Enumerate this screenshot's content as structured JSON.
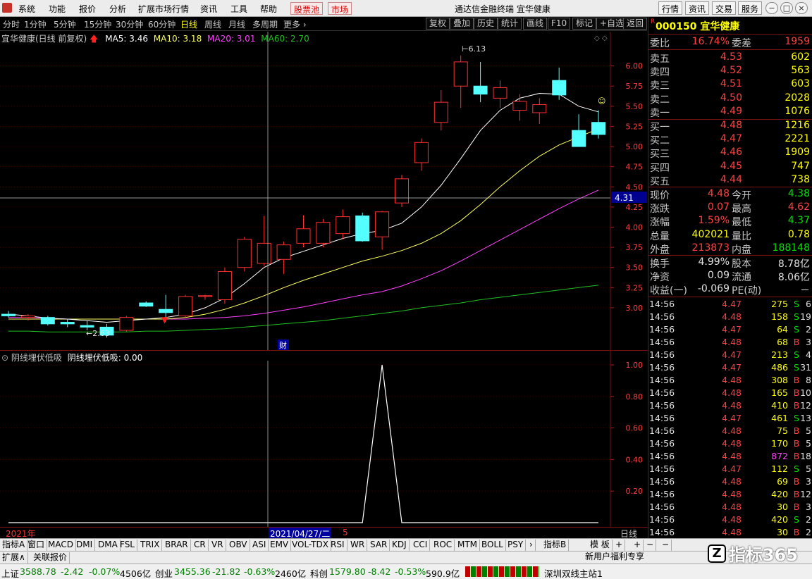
{
  "menu": {
    "items": [
      "系统",
      "功能",
      "报价",
      "分析",
      "扩展市场行情",
      "资讯",
      "工具",
      "帮助"
    ],
    "red_buttons": [
      "股票池",
      "市场"
    ],
    "app_title": "通达信金融终端",
    "stock_title": "宜华健康",
    "right_buttons": [
      "行情",
      "资讯",
      "交易",
      "服务"
    ]
  },
  "periods": {
    "items": [
      "分时",
      "1分钟",
      "5分钟",
      "15分钟",
      "30分钟",
      "60分钟",
      "日线",
      "周线",
      "月线",
      "多周期",
      "更多"
    ],
    "active": "日线",
    "tools": [
      "复权",
      "叠加",
      "历史",
      "统计",
      "画线",
      "F10",
      "标记",
      "+自选",
      "返回"
    ]
  },
  "chart_info": {
    "name": "宜华健康(日线 前复权)",
    "ma5": "MA5: 3.46",
    "ma10": "MA10: 3.18",
    "ma20": "MA20: 3.01",
    "ma60": "MA60: 2.70",
    "high_label": "6.13",
    "low_label": "2.63",
    "crosshair_price": "4.31",
    "cai_label": "财",
    "year_label": "2021年",
    "date_label": "2021/04/27/二",
    "month_label": "5",
    "period_label": "日线",
    "colors": {
      "up": "#ff3030",
      "down": "#54ffff",
      "ma5": "#ffffff",
      "ma10": "#ffff60",
      "ma20": "#ff40ff",
      "ma60": "#20c020"
    }
  },
  "indicator": {
    "title": "阴线埋伏低吸",
    "value": "阴线埋伏低吸: 0.00"
  },
  "chart_data": [
    {
      "type": "candlestick",
      "title": "宜华健康(日线 前复权)",
      "y_ticks": [
        "6.00",
        "5.75",
        "5.50",
        "5.25",
        "5.00",
        "4.75",
        "4.50",
        "4.25",
        "4.00",
        "3.75",
        "3.50",
        "3.25",
        "3.00"
      ],
      "ylim": [
        2.58,
        6.25
      ],
      "ohlc": [
        [
          2.92,
          2.96,
          2.88,
          2.9
        ],
        [
          2.88,
          2.92,
          2.84,
          2.9
        ],
        [
          2.88,
          2.9,
          2.78,
          2.8
        ],
        [
          2.82,
          2.86,
          2.76,
          2.8
        ],
        [
          2.78,
          2.84,
          2.72,
          2.76
        ],
        [
          2.76,
          2.8,
          2.63,
          2.66
        ],
        [
          2.72,
          2.9,
          2.7,
          2.88
        ],
        [
          3.06,
          3.08,
          3.01,
          3.02
        ],
        [
          2.98,
          3.16,
          2.88,
          2.94
        ],
        [
          2.9,
          3.16,
          2.88,
          3.14
        ],
        [
          3.14,
          3.16,
          3.1,
          3.15
        ],
        [
          3.1,
          3.5,
          3.05,
          3.45
        ],
        [
          3.5,
          3.88,
          3.45,
          3.85
        ],
        [
          3.55,
          4.14,
          3.52,
          3.8
        ],
        [
          3.6,
          3.82,
          3.42,
          3.78
        ],
        [
          3.8,
          4.15,
          3.75,
          3.98
        ],
        [
          3.8,
          4.1,
          3.75,
          4.06
        ],
        [
          3.92,
          4.22,
          3.85,
          4.13
        ],
        [
          4.14,
          4.18,
          3.82,
          3.83
        ],
        [
          3.88,
          4.2,
          3.72,
          4.19
        ],
        [
          4.3,
          4.65,
          4.25,
          4.6
        ],
        [
          4.8,
          5.1,
          4.7,
          5.05
        ],
        [
          5.3,
          5.7,
          5.2,
          5.55
        ],
        [
          5.75,
          6.13,
          5.48,
          6.05
        ],
        [
          5.75,
          6.05,
          5.55,
          5.65
        ],
        [
          5.6,
          5.82,
          5.48,
          5.73
        ],
        [
          5.45,
          5.65,
          5.32,
          5.56
        ],
        [
          5.42,
          5.6,
          5.28,
          5.52
        ],
        [
          5.82,
          5.98,
          5.58,
          5.64
        ],
        [
          5.2,
          5.4,
          5.0,
          5.0
        ],
        [
          5.3,
          5.45,
          5.1,
          5.15
        ]
      ],
      "ma5": [
        2.92,
        2.9,
        2.87,
        2.86,
        2.84,
        2.82,
        2.84,
        2.86,
        2.88,
        2.92,
        3.0,
        3.12,
        3.3,
        3.5,
        3.62,
        3.7,
        3.78,
        3.86,
        3.92,
        3.96,
        4.05,
        4.25,
        4.52,
        4.85,
        5.2,
        5.45,
        5.6,
        5.66,
        5.65,
        5.5,
        5.43
      ],
      "ma10": [
        2.86,
        2.86,
        2.86,
        2.86,
        2.86,
        2.86,
        2.86,
        2.86,
        2.86,
        2.88,
        2.92,
        2.98,
        3.06,
        3.15,
        3.25,
        3.34,
        3.42,
        3.5,
        3.58,
        3.64,
        3.71,
        3.8,
        3.92,
        4.08,
        4.28,
        4.5,
        4.7,
        4.88,
        5.02,
        5.12,
        5.22
      ],
      "ma20": [
        2.88,
        2.88,
        2.87,
        2.86,
        2.86,
        2.86,
        2.86,
        2.86,
        2.86,
        2.86,
        2.87,
        2.88,
        2.9,
        2.93,
        2.97,
        3.01,
        3.06,
        3.11,
        3.16,
        3.2,
        3.27,
        3.36,
        3.46,
        3.58,
        3.71,
        3.84,
        3.97,
        4.1,
        4.23,
        4.35,
        4.46
      ],
      "ma60": [
        2.71,
        2.71,
        2.7,
        2.7,
        2.7,
        2.7,
        2.7,
        2.71,
        2.71,
        2.72,
        2.73,
        2.74,
        2.76,
        2.78,
        2.8,
        2.82,
        2.84,
        2.87,
        2.9,
        2.93,
        2.96,
        3.0,
        3.03,
        3.06,
        3.1,
        3.13,
        3.16,
        3.19,
        3.22,
        3.25,
        3.28
      ]
    },
    {
      "type": "line",
      "title": "阴线埋伏低吸",
      "y_ticks": [
        "1.00",
        "0.80",
        "0.60",
        "0.40",
        "0.20"
      ],
      "ylim": [
        0,
        1.0
      ],
      "values": [
        0,
        0,
        0,
        0,
        0,
        0,
        0,
        0,
        0,
        0,
        0,
        0,
        0,
        0,
        0,
        0,
        0,
        0,
        0,
        1,
        0,
        0,
        0,
        0,
        0,
        0,
        0,
        0,
        0,
        0,
        0
      ]
    }
  ],
  "quote": {
    "code": "000150",
    "name": "宜华健康",
    "r_mark": "R",
    "weibi_label": "委比",
    "weibi": "16.74%",
    "weicha_label": "委差",
    "weicha": "1959",
    "asks": [
      {
        "label": "卖五",
        "price": "4.53",
        "vol": "602"
      },
      {
        "label": "卖四",
        "price": "4.52",
        "vol": "563"
      },
      {
        "label": "卖三",
        "price": "4.51",
        "vol": "603"
      },
      {
        "label": "卖二",
        "price": "4.50",
        "vol": "2028"
      },
      {
        "label": "卖一",
        "price": "4.49",
        "vol": "1076"
      }
    ],
    "bids": [
      {
        "label": "买一",
        "price": "4.48",
        "vol": "1216"
      },
      {
        "label": "买二",
        "price": "4.47",
        "vol": "2221"
      },
      {
        "label": "买三",
        "price": "4.46",
        "vol": "1909"
      },
      {
        "label": "买四",
        "price": "4.45",
        "vol": "747"
      },
      {
        "label": "买五",
        "price": "4.44",
        "vol": "738"
      }
    ],
    "stats": [
      {
        "l1": "现价",
        "v1": "4.48",
        "c1": "red",
        "l2": "今开",
        "v2": "4.38",
        "c2": "green"
      },
      {
        "l1": "涨跌",
        "v1": "0.07",
        "c1": "red",
        "l2": "最高",
        "v2": "4.62",
        "c2": "red"
      },
      {
        "l1": "涨幅",
        "v1": "1.59%",
        "c1": "red",
        "l2": "最低",
        "v2": "4.37",
        "c2": "green"
      },
      {
        "l1": "总量",
        "v1": "402021",
        "c1": "yellow",
        "l2": "量比",
        "v2": "0.78",
        "c2": "yellow"
      },
      {
        "l1": "外盘",
        "v1": "213873",
        "c1": "red",
        "l2": "内盘",
        "v2": "188148",
        "c2": "green"
      }
    ],
    "stats2": [
      {
        "l1": "换手",
        "v1": "4.99%",
        "l2": "股本",
        "v2": "8.78亿"
      },
      {
        "l1": "净资",
        "v1": "0.09",
        "l2": "流通",
        "v2": "8.06亿"
      },
      {
        "l1": "收益(一)",
        "v1": "-0.069",
        "l2": "PE(动)",
        "v2": "－"
      }
    ],
    "ticks": [
      {
        "t": "14:56",
        "p": "4.47",
        "pc": "red",
        "v": "275",
        "bs": "S",
        "n": "6"
      },
      {
        "t": "14:56",
        "p": "4.48",
        "pc": "red",
        "v": "158",
        "bs": "S",
        "n": "19"
      },
      {
        "t": "14:56",
        "p": "4.47",
        "pc": "red",
        "v": "64",
        "bs": "S",
        "n": "2"
      },
      {
        "t": "14:56",
        "p": "4.48",
        "pc": "red",
        "v": "68",
        "bs": "B",
        "n": "3"
      },
      {
        "t": "14:56",
        "p": "4.47",
        "pc": "red",
        "v": "213",
        "bs": "S",
        "n": "4"
      },
      {
        "t": "14:56",
        "p": "4.47",
        "pc": "red",
        "v": "486",
        "bs": "S",
        "n": "31"
      },
      {
        "t": "14:56",
        "p": "4.48",
        "pc": "red",
        "v": "308",
        "bs": "B",
        "n": "8"
      },
      {
        "t": "14:56",
        "p": "4.48",
        "pc": "red",
        "v": "165",
        "bs": "B",
        "n": "10"
      },
      {
        "t": "14:56",
        "p": "4.48",
        "pc": "red",
        "v": "410",
        "bs": "B",
        "n": "12"
      },
      {
        "t": "14:56",
        "p": "4.47",
        "pc": "red",
        "v": "461",
        "bs": "S",
        "n": "13"
      },
      {
        "t": "14:56",
        "p": "4.48",
        "pc": "red",
        "v": "75",
        "bs": "B",
        "n": "5"
      },
      {
        "t": "14:56",
        "p": "4.48",
        "pc": "red",
        "v": "170",
        "bs": "B",
        "n": "5"
      },
      {
        "t": "14:56",
        "p": "4.48",
        "pc": "red",
        "v": "872",
        "bs": "B",
        "n": "18",
        "vc": "magenta"
      },
      {
        "t": "14:56",
        "p": "4.47",
        "pc": "red",
        "v": "112",
        "bs": "S",
        "n": "5"
      },
      {
        "t": "14:56",
        "p": "4.48",
        "pc": "red",
        "v": "69",
        "bs": "B",
        "n": "3"
      },
      {
        "t": "14:56",
        "p": "4.48",
        "pc": "red",
        "v": "420",
        "bs": "B",
        "n": "12"
      },
      {
        "t": "14:56",
        "p": "4.48",
        "pc": "red",
        "v": "30",
        "bs": "B",
        "n": "3"
      },
      {
        "t": "14:56",
        "p": "4.48",
        "pc": "red",
        "v": "420",
        "bs": "S",
        "n": "2"
      },
      {
        "t": "14:56",
        "p": "4.48",
        "pc": "red",
        "v": "30",
        "bs": "B",
        "n": "2"
      }
    ]
  },
  "tabs": {
    "items": [
      "指标A",
      "窗口",
      "MACD",
      "DMI",
      "DMA",
      "FSL",
      "TRIX",
      "BRAR",
      "CR",
      "VR",
      "OBV",
      "ASI",
      "EMV",
      "VOL-TDX",
      "RSI",
      "WR",
      "SAR",
      "KDJ",
      "CCI",
      "ROC",
      "MTM",
      "BOLL",
      "PSY"
    ],
    "right": [
      "指标B",
      "模 板",
      "+",
      "+",
      "−",
      "−"
    ]
  },
  "bar2": {
    "left": [
      "扩展∧",
      "关联报价"
    ]
  },
  "status": {
    "sh_label": "上证",
    "sh": "3588.78",
    "sh_chg": "-2.42",
    "sh_pct": "-0.07%",
    "sh_amt": "4506亿",
    "cy_label": "创业",
    "cy": "3455.36",
    "cy_chg": "-21.82",
    "cy_pct": "-0.63%",
    "cy_amt": "2460亿",
    "kc_label": "科创",
    "kc": "1579.80",
    "kc_chg": "-8.42",
    "kc_pct": "-0.53%",
    "kc_amt": "590.9亿",
    "site": "深圳双线主站1",
    "news": "新用户福利专享",
    "watermark": "指标365"
  }
}
